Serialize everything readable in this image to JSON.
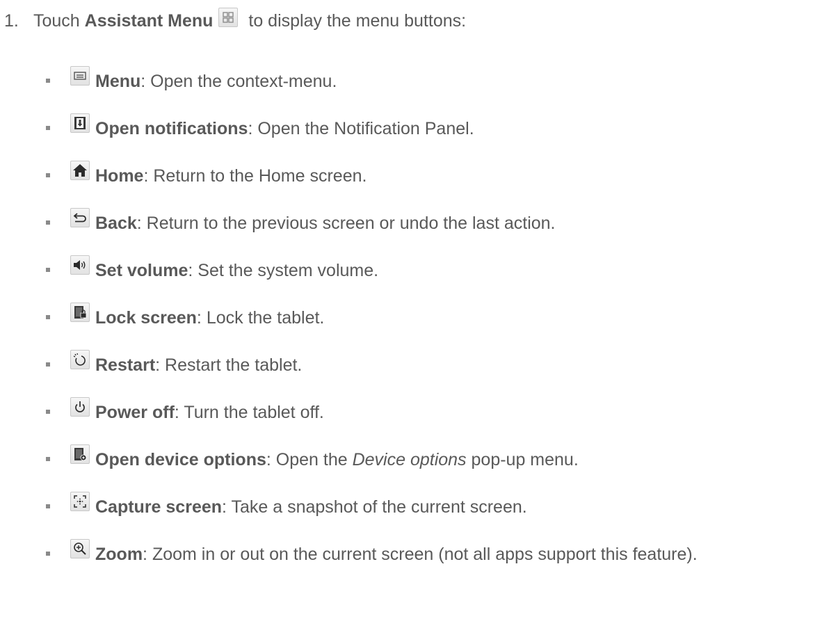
{
  "step": {
    "number": "1.",
    "prefix": "Touch ",
    "strong": "Assistant Menu",
    "icon": "assistant-menu-grid-icon",
    "suffix": " to display the menu buttons:"
  },
  "items": [
    {
      "icon": "menu-icon",
      "term": "Menu",
      "desc": ": Open the context-menu."
    },
    {
      "icon": "notifications-icon",
      "term": "Open notifications",
      "desc": ": Open the Notification Panel."
    },
    {
      "icon": "home-icon",
      "term": "Home",
      "desc": ": Return to the Home screen."
    },
    {
      "icon": "back-icon",
      "term": "Back",
      "desc": ": Return to the previous screen or undo the last action."
    },
    {
      "icon": "volume-icon",
      "term": "Set volume",
      "desc": ": Set the system volume."
    },
    {
      "icon": "lock-screen-icon",
      "term": "Lock screen",
      "desc": ": Lock the tablet."
    },
    {
      "icon": "restart-icon",
      "term": "Restart",
      "desc": ": Restart the tablet."
    },
    {
      "icon": "power-icon",
      "term": "Power off",
      "desc": ": Turn the tablet off."
    },
    {
      "icon": "device-options-icon",
      "term": "Open device options",
      "desc_before": ": Open the ",
      "desc_em": "Device options",
      "desc_after": " pop-up menu."
    },
    {
      "icon": "capture-screen-icon",
      "term": "Capture screen",
      "desc": ": Take a snapshot of the current screen."
    },
    {
      "icon": "zoom-icon",
      "term": "Zoom",
      "desc": ": Zoom in or out on the current screen (not all apps support this feature)."
    }
  ]
}
